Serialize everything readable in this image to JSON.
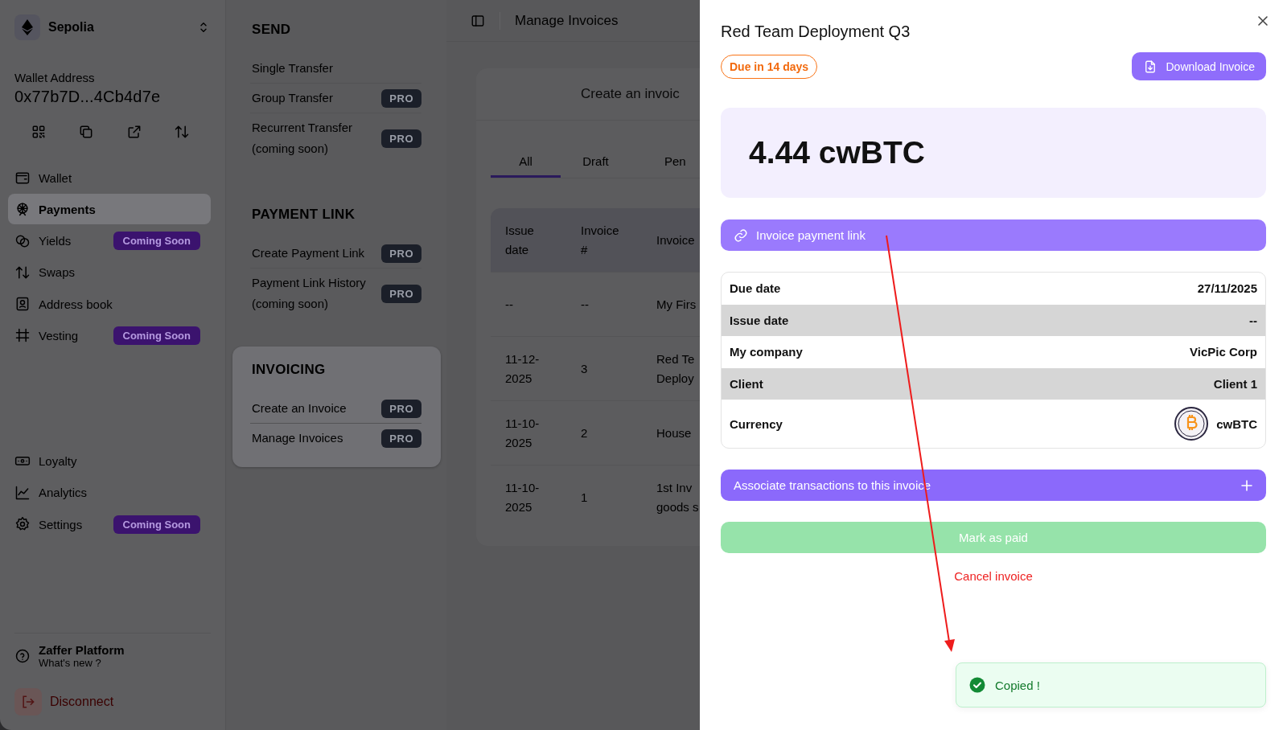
{
  "sidebar": {
    "network": "Sepolia",
    "wallet_label": "Wallet Address",
    "wallet_address": "0x77b7D...4Cb4d7e",
    "nav_items": [
      {
        "label": "Wallet",
        "selected": false
      },
      {
        "label": "Payments",
        "selected": true
      },
      {
        "label": "Yields",
        "selected": false,
        "badge": "Coming Soon"
      },
      {
        "label": "Swaps",
        "selected": false
      },
      {
        "label": "Address book",
        "selected": false
      },
      {
        "label": "Vesting",
        "selected": false,
        "badge": "Coming Soon"
      }
    ],
    "bottom_items": [
      {
        "label": "Loyalty",
        "selected": false
      },
      {
        "label": "Analytics",
        "selected": false
      },
      {
        "label": "Settings",
        "selected": false,
        "badge": "Coming Soon"
      }
    ],
    "platform": {
      "title": "Zaffer Platform",
      "subtitle": "What's new ?"
    },
    "disconnect": "Disconnect"
  },
  "menu": {
    "sections": [
      {
        "title": "SEND",
        "selected": false,
        "items": [
          {
            "label": "Single Transfer"
          },
          {
            "label": "Group Transfer",
            "badge": "PRO"
          },
          {
            "label": "Recurrent Transfer (coming soon)",
            "badge": "PRO"
          }
        ]
      },
      {
        "title": "PAYMENT LINK",
        "selected": false,
        "items": [
          {
            "label": "Create Payment Link",
            "badge": "PRO"
          },
          {
            "label": "Payment Link History (coming soon)",
            "badge": "PRO"
          }
        ]
      },
      {
        "title": "INVOICING",
        "selected": true,
        "items": [
          {
            "label": "Create an Invoice",
            "badge": "PRO"
          },
          {
            "label": "Manage Invoices",
            "badge": "PRO"
          }
        ]
      }
    ]
  },
  "main": {
    "title": "Manage Invoices",
    "banner": "Create an invoic",
    "tabs": [
      {
        "label": "All",
        "selected": true
      },
      {
        "label": "Draft",
        "selected": false
      },
      {
        "label": "Pen",
        "selected": false
      }
    ],
    "table": {
      "columns": [
        "Issue date",
        "Invoice #",
        "Invoice"
      ],
      "rows": [
        [
          "--",
          "--",
          "My Firs"
        ],
        [
          "11-12-2025",
          "3",
          "Red Te\nDeploy"
        ],
        [
          "11-10-2025",
          "2",
          "House"
        ],
        [
          "11-10-2025",
          "1",
          "1st Inv\ngoods s"
        ]
      ]
    }
  },
  "drawer": {
    "title": "Red Team Deployment Q3",
    "due_badge": "Due in 14 days",
    "download_button": "Download Invoice",
    "amount": "4.44 cwBTC",
    "link_button": "Invoice payment link",
    "details": [
      {
        "kind": "text",
        "label": "Due date",
        "value": "27/11/2025"
      },
      {
        "kind": "text",
        "label": "Issue date",
        "value": "--"
      },
      {
        "kind": "text",
        "label": "My company",
        "value": "VicPic Corp"
      },
      {
        "kind": "text",
        "label": "Client",
        "value": "Client 1"
      },
      {
        "kind": "token",
        "label": "Currency",
        "value": "cwBTC"
      }
    ],
    "associate_button": "Associate transactions to this invoice",
    "mark_paid": {
      "label": "Mark as paid",
      "disabled": true
    },
    "cancel_link": "Cancel invoice"
  },
  "toast": {
    "message": "Copied !"
  }
}
